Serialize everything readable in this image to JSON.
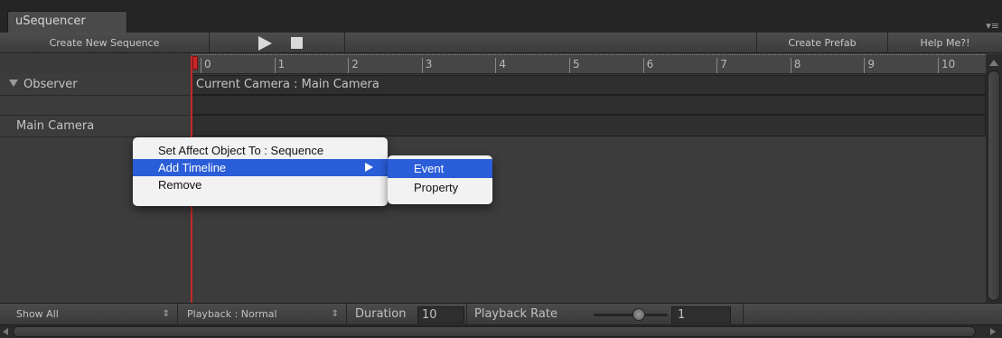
{
  "window": {
    "tab_title": "uSequencer",
    "tab_menu_glyph": "▾≡"
  },
  "toolbar": {
    "create_new_sequence": "Create New Sequence",
    "play_icon": "play-icon",
    "stop_icon": "stop-icon",
    "create_prefab": "Create Prefab",
    "help": "Help Me?!"
  },
  "ruler": {
    "ticks": [
      "0",
      "1",
      "2",
      "3",
      "4",
      "5",
      "6",
      "7",
      "8",
      "9",
      "10"
    ]
  },
  "tracks": {
    "observer_label": "Observer",
    "observer_value": "Current Camera : Main Camera",
    "main_camera_label": "Main Camera"
  },
  "context_menu": {
    "items": [
      "Set Affect Object To : Sequence",
      "Add Timeline",
      "Remove"
    ],
    "highlighted": "Add Timeline"
  },
  "submenu": {
    "items": [
      "Event",
      "Property"
    ],
    "highlighted": "Event"
  },
  "bottom_bar": {
    "show_filter": "Show All",
    "playback_mode": "Playback : Normal",
    "duration_label": "Duration",
    "duration_value": "10",
    "playback_rate_label": "Playback Rate",
    "playback_rate_value": "1",
    "select_arrow": "⇕"
  },
  "colors": {
    "playhead": "#c62828",
    "menu_highlight": "#2a5dd8"
  }
}
